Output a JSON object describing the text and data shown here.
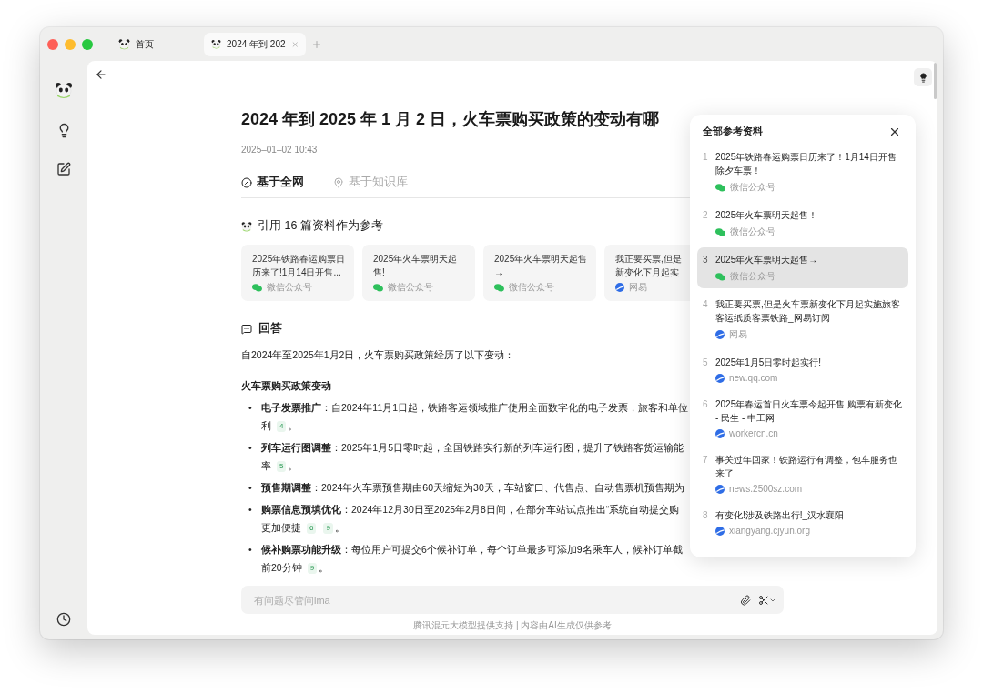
{
  "tabs": [
    {
      "label": "首页",
      "selected": false
    },
    {
      "label": "2024 年到 202",
      "selected": true
    }
  ],
  "page": {
    "title": "2024 年到 2025 年 1 月 2 日，火车票购买政策的变动有哪",
    "timestamp": "2025–01–02 10:43",
    "modes": [
      {
        "label": "基于全网",
        "kind": "web",
        "selected": true
      },
      {
        "label": "基于知识库",
        "kind": "knowledge",
        "selected": false
      }
    ],
    "references_heading": "引用 16 篇资料作为参考",
    "source_cards": [
      {
        "title_lines": [
          "2025年铁路春运购票日",
          "历来了!1月14日开售..."
        ],
        "source": "微信公众号",
        "kind": "wechat"
      },
      {
        "title_lines": [
          "2025年火车票明天起",
          "售!"
        ],
        "source": "微信公众号",
        "kind": "wechat"
      },
      {
        "title_lines": [
          "2025年火车票明天起售",
          "→"
        ],
        "source": "微信公众号",
        "kind": "wechat"
      },
      {
        "title_lines": [
          "我正要买票,但是",
          "新变化下月起实"
        ],
        "source": "网易",
        "kind": "web"
      }
    ],
    "answer": {
      "heading": "回答",
      "intro": "自2024年至2025年1月2日，火车票购买政策经历了以下变动：",
      "section_title": "火车票购买政策变动",
      "items": [
        {
          "marker": "•",
          "lines": [
            "**电子发票推广**：自2024年11月1日起，铁路客运领域推广使用全面数字化的电子发票，旅客和单位",
            "利"
          ],
          "refs": [
            "4"
          ],
          "tail": "。"
        },
        {
          "marker": "•",
          "lines": [
            "**列车运行图调整**：2025年1月5日零时起，全国铁路实行新的列车运行图，提升了铁路客货运输能",
            "率"
          ],
          "refs": [
            "5"
          ],
          "tail": "。"
        },
        {
          "marker": "•",
          "lines": [
            "**预售期调整**：2024年火车票预售期由60天缩短为30天，车站窗口、代售点、自动售票机预售期为"
          ]
        },
        {
          "marker": "•",
          "lines": [
            "**购票信息预填优化**：2024年12月30日至2025年2月8日间，在部分车站试点推出“系统自动提交购",
            "更加便捷"
          ],
          "refs": [
            "6",
            "9"
          ],
          "tail": "。"
        },
        {
          "marker": "•",
          "lines": [
            "**候补购票功能升级**：每位用户可提交6个候补订单，每个订单最多可添加9名乘车人，候补订单截",
            "前20分钟"
          ],
          "refs": [
            "9"
          ],
          "tail": "。"
        }
      ]
    },
    "composer": {
      "placeholder": "有问题尽管问ima"
    },
    "disclaimer": "腾讯混元大模型提供支持 | 内容由AI生成仅供参考"
  },
  "references_panel": {
    "title": "全部参考资料",
    "items": [
      {
        "number": "1",
        "title": "2025年铁路春运购票日历来了！1月14日开售除夕车票！",
        "source": "微信公众号",
        "kind": "wechat",
        "selected": false
      },
      {
        "number": "2",
        "title": "2025年火车票明天起售！",
        "source": "微信公众号",
        "kind": "wechat",
        "selected": false
      },
      {
        "number": "3",
        "title": "2025年火车票明天起售→",
        "source": "微信公众号",
        "kind": "wechat",
        "selected": true
      },
      {
        "number": "4",
        "title": "我正要买票,但是火车票新变化下月起实施旅客客运纸质客票铁路_网易订阅",
        "source": "网易",
        "kind": "web",
        "selected": false
      },
      {
        "number": "5",
        "title": "2025年1月5日零时起实行!",
        "source": "new.qq.com",
        "kind": "web",
        "selected": false
      },
      {
        "number": "6",
        "title": "2025年春运首日火车票今起开售 购票有新变化 - 民生 - 中工网",
        "source": "workercn.cn",
        "kind": "web",
        "selected": false
      },
      {
        "number": "7",
        "title": "事关过年回家！铁路运行有调整，包车服务也来了",
        "source": "news.2500sz.com",
        "kind": "web",
        "selected": false
      },
      {
        "number": "8",
        "title": "有变化!涉及铁路出行!_汉水襄阳",
        "source": "xiangyang.cjyun.org",
        "kind": "web",
        "selected": false
      }
    ]
  }
}
